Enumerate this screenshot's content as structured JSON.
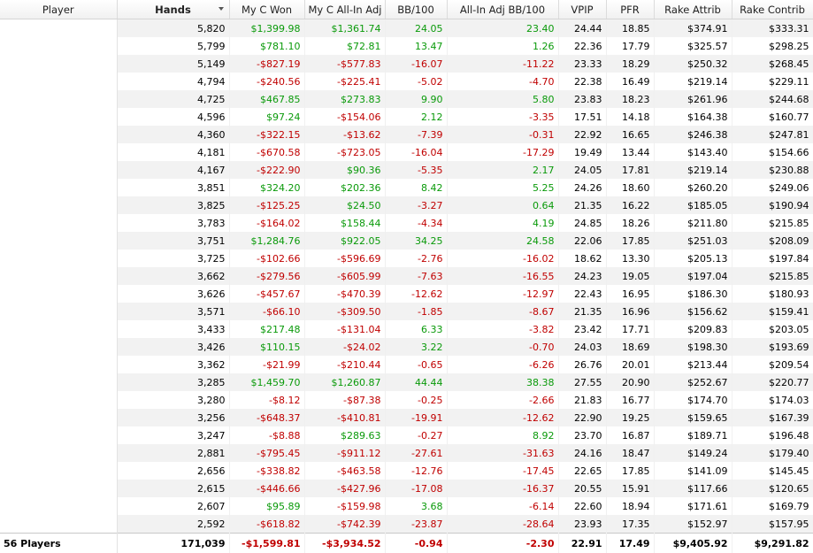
{
  "columns": [
    "Player",
    "Hands",
    "My C Won",
    "My C All-In Adj",
    "BB/100",
    "All-In Adj BB/100",
    "VPIP",
    "PFR",
    "Rake Attrib",
    "Rake Contrib"
  ],
  "sorted_column": "Hands",
  "colors": {
    "positive": "#0a9a0a",
    "negative": "#c00000"
  },
  "rows": [
    [
      "",
      "5,820",
      "$1,399.98",
      "$1,361.74",
      "24.05",
      "23.40",
      "24.44",
      "18.85",
      "$374.91",
      "$333.31"
    ],
    [
      "",
      "5,799",
      "$781.10",
      "$72.81",
      "13.47",
      "1.26",
      "22.36",
      "17.79",
      "$325.57",
      "$298.25"
    ],
    [
      "",
      "5,149",
      "-$827.19",
      "-$577.83",
      "-16.07",
      "-11.22",
      "23.33",
      "18.29",
      "$250.32",
      "$268.45"
    ],
    [
      "",
      "4,794",
      "-$240.56",
      "-$225.41",
      "-5.02",
      "-4.70",
      "22.38",
      "16.49",
      "$219.14",
      "$229.11"
    ],
    [
      "",
      "4,725",
      "$467.85",
      "$273.83",
      "9.90",
      "5.80",
      "23.83",
      "18.23",
      "$261.96",
      "$244.68"
    ],
    [
      "",
      "4,596",
      "$97.24",
      "-$154.06",
      "2.12",
      "-3.35",
      "17.51",
      "14.18",
      "$164.38",
      "$160.77"
    ],
    [
      "",
      "4,360",
      "-$322.15",
      "-$13.62",
      "-7.39",
      "-0.31",
      "22.92",
      "16.65",
      "$246.38",
      "$247.81"
    ],
    [
      "",
      "4,181",
      "-$670.58",
      "-$723.05",
      "-16.04",
      "-17.29",
      "19.49",
      "13.44",
      "$143.40",
      "$154.66"
    ],
    [
      "",
      "4,167",
      "-$222.90",
      "$90.36",
      "-5.35",
      "2.17",
      "24.05",
      "17.81",
      "$219.14",
      "$230.88"
    ],
    [
      "",
      "3,851",
      "$324.20",
      "$202.36",
      "8.42",
      "5.25",
      "24.26",
      "18.60",
      "$260.20",
      "$249.06"
    ],
    [
      "",
      "3,825",
      "-$125.25",
      "$24.50",
      "-3.27",
      "0.64",
      "21.35",
      "16.22",
      "$185.05",
      "$190.94"
    ],
    [
      "",
      "3,783",
      "-$164.02",
      "$158.44",
      "-4.34",
      "4.19",
      "24.85",
      "18.26",
      "$211.80",
      "$215.85"
    ],
    [
      "",
      "3,751",
      "$1,284.76",
      "$922.05",
      "34.25",
      "24.58",
      "22.06",
      "17.85",
      "$251.03",
      "$208.09"
    ],
    [
      "",
      "3,725",
      "-$102.66",
      "-$596.69",
      "-2.76",
      "-16.02",
      "18.62",
      "13.30",
      "$205.13",
      "$197.84"
    ],
    [
      "",
      "3,662",
      "-$279.56",
      "-$605.99",
      "-7.63",
      "-16.55",
      "24.23",
      "19.05",
      "$197.04",
      "$215.85"
    ],
    [
      "",
      "3,626",
      "-$457.67",
      "-$470.39",
      "-12.62",
      "-12.97",
      "22.43",
      "16.95",
      "$186.30",
      "$180.93"
    ],
    [
      "",
      "3,571",
      "-$66.10",
      "-$309.50",
      "-1.85",
      "-8.67",
      "21.35",
      "16.96",
      "$156.62",
      "$159.41"
    ],
    [
      "",
      "3,433",
      "$217.48",
      "-$131.04",
      "6.33",
      "-3.82",
      "23.42",
      "17.71",
      "$209.83",
      "$203.05"
    ],
    [
      "",
      "3,426",
      "$110.15",
      "-$24.02",
      "3.22",
      "-0.70",
      "24.03",
      "18.69",
      "$198.30",
      "$193.69"
    ],
    [
      "",
      "3,362",
      "-$21.99",
      "-$210.44",
      "-0.65",
      "-6.26",
      "26.76",
      "20.01",
      "$213.44",
      "$209.54"
    ],
    [
      "",
      "3,285",
      "$1,459.70",
      "$1,260.87",
      "44.44",
      "38.38",
      "27.55",
      "20.90",
      "$252.67",
      "$220.77"
    ],
    [
      "",
      "3,280",
      "-$8.12",
      "-$87.38",
      "-0.25",
      "-2.66",
      "21.83",
      "16.77",
      "$174.70",
      "$174.03"
    ],
    [
      "",
      "3,256",
      "-$648.37",
      "-$410.81",
      "-19.91",
      "-12.62",
      "22.90",
      "19.25",
      "$159.65",
      "$167.39"
    ],
    [
      "",
      "3,247",
      "-$8.88",
      "$289.63",
      "-0.27",
      "8.92",
      "23.70",
      "16.87",
      "$189.71",
      "$196.48"
    ],
    [
      "",
      "2,881",
      "-$795.45",
      "-$911.12",
      "-27.61",
      "-31.63",
      "24.16",
      "18.47",
      "$149.24",
      "$179.40"
    ],
    [
      "",
      "2,656",
      "-$338.82",
      "-$463.58",
      "-12.76",
      "-17.45",
      "22.65",
      "17.85",
      "$141.09",
      "$145.45"
    ],
    [
      "",
      "2,615",
      "-$446.66",
      "-$427.96",
      "-17.08",
      "-16.37",
      "20.55",
      "15.91",
      "$117.66",
      "$120.65"
    ],
    [
      "",
      "2,607",
      "$95.89",
      "-$159.98",
      "3.68",
      "-6.14",
      "22.60",
      "18.94",
      "$171.61",
      "$169.79"
    ],
    [
      "",
      "2,592",
      "-$618.82",
      "-$742.39",
      "-23.87",
      "-28.64",
      "23.93",
      "17.35",
      "$152.97",
      "$157.95"
    ]
  ],
  "totals": [
    "56 Players",
    "171,039",
    "-$1,599.81",
    "-$3,934.52",
    "-0.94",
    "-2.30",
    "22.91",
    "17.49",
    "$9,405.92",
    "$9,291.82"
  ]
}
